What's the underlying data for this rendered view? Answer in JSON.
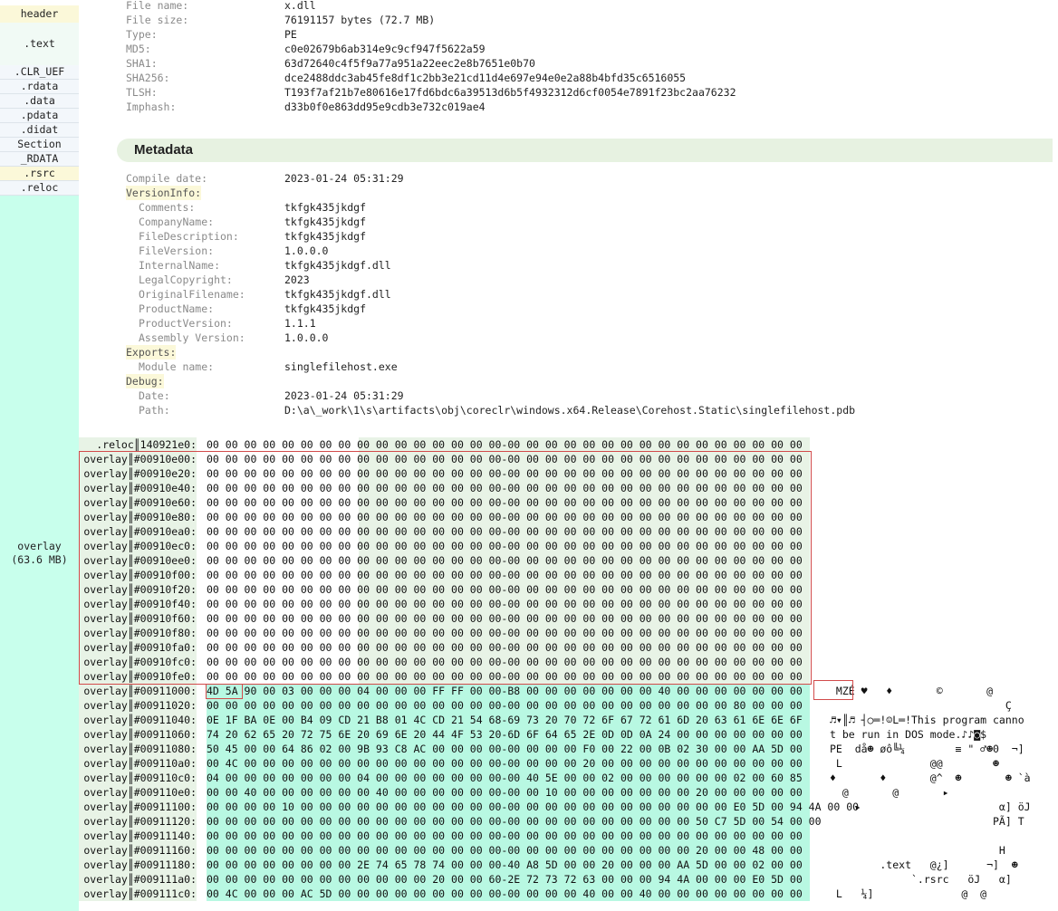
{
  "sidebar": {
    "items": [
      {
        "label": "header"
      },
      {
        "label": ".text"
      },
      {
        "label": ".CLR_UEF"
      },
      {
        "label": ".rdata"
      },
      {
        "label": ".data"
      },
      {
        "label": ".pdata"
      },
      {
        "label": ".didat"
      },
      {
        "label": "Section"
      },
      {
        "label": "_RDATA"
      },
      {
        "label": ".rsrc"
      },
      {
        "label": ".reloc"
      }
    ],
    "overlay": {
      "label": "overlay",
      "size": "(63.6 MB)"
    }
  },
  "file_info": [
    {
      "key": "File name:",
      "value": "x.dll"
    },
    {
      "key": "File size:",
      "value": "76191157 bytes (72.7 MB)"
    },
    {
      "key": "Type:",
      "value": "PE"
    },
    {
      "key": "MD5:",
      "value": "c0e02679b6ab314e9c9cf947f5622a59"
    },
    {
      "key": "SHA1:",
      "value": "63d72640c4f5f9a77a951a22eec2e8b7651e0b70"
    },
    {
      "key": "SHA256:",
      "value": "dce2488ddc3ab45fe8df1c2bb3e21cd11d4e697e94e0e2a88b4bfd35c6516055"
    },
    {
      "key": "TLSH:",
      "value": "T193f7af21b7e80616e17fd6bdc6a39513d6b5f4932312d6cf0054e7891f23bc2aa76232"
    },
    {
      "key": "Imphash:",
      "value": "d33b0f0e863dd95e9cdb3e732c019ae4"
    }
  ],
  "metadata": {
    "title": "Metadata",
    "rows": [
      {
        "key": "Compile date:",
        "value": "2023-01-24 05:31:29",
        "indent": false,
        "section": false
      },
      {
        "key": "VersionInfo:",
        "value": "",
        "indent": false,
        "section": true
      },
      {
        "key": "Comments:",
        "value": "tkfgk435jkdgf",
        "indent": true,
        "section": false
      },
      {
        "key": "CompanyName:",
        "value": "tkfgk435jkdgf",
        "indent": true,
        "section": false
      },
      {
        "key": "FileDescription:",
        "value": "tkfgk435jkdgf",
        "indent": true,
        "section": false
      },
      {
        "key": "FileVersion:",
        "value": "1.0.0.0",
        "indent": true,
        "section": false
      },
      {
        "key": "InternalName:",
        "value": "tkfgk435jkdgf.dll",
        "indent": true,
        "section": false
      },
      {
        "key": "LegalCopyright:",
        "value": "2023",
        "indent": true,
        "section": false
      },
      {
        "key": "OriginalFilename:",
        "value": "tkfgk435jkdgf.dll",
        "indent": true,
        "section": false
      },
      {
        "key": "ProductName:",
        "value": "tkfgk435jkdgf",
        "indent": true,
        "section": false
      },
      {
        "key": "ProductVersion:",
        "value": "1.1.1",
        "indent": true,
        "section": false
      },
      {
        "key": "Assembly Version:",
        "value": "1.0.0.0",
        "indent": true,
        "section": false
      },
      {
        "key": "Exports:",
        "value": "",
        "indent": false,
        "section": true
      },
      {
        "key": "Module name:",
        "value": "singlefilehost.exe",
        "indent": true,
        "section": false
      },
      {
        "key": "Debug:",
        "value": "",
        "indent": false,
        "section": true
      },
      {
        "key": "Date:",
        "value": "2023-01-24 05:31:29",
        "indent": true,
        "section": false
      },
      {
        "key": "Path:",
        "value": "D:\\a\\_work\\1\\s\\artifacts\\obj\\coreclr\\windows.x64.Release\\Corehost.Static\\singlefilehost.pdb",
        "indent": true,
        "section": false
      }
    ]
  },
  "hex": {
    "rows": [
      {
        "label": ".reloc║140921e0:",
        "bytes": "00 00 00 00 00 00 00 00 00 00 00 00 00 00 00 00-00 00 00 00 00 00 00 00 00 00 00 00 00 00 00 00",
        "ascii": "",
        "region": "reloc"
      },
      {
        "label": "overlay║#00910e00:",
        "bytes": "00 00 00 00 00 00 00 00 00 00 00 00 00 00 00 00-00 00 00 00 00 00 00 00 00 00 00 00 00 00 00 00",
        "ascii": "",
        "region": "zero"
      },
      {
        "label": "overlay║#00910e20:",
        "bytes": "00 00 00 00 00 00 00 00 00 00 00 00 00 00 00 00-00 00 00 00 00 00 00 00 00 00 00 00 00 00 00 00",
        "ascii": "",
        "region": "zero"
      },
      {
        "label": "overlay║#00910e40:",
        "bytes": "00 00 00 00 00 00 00 00 00 00 00 00 00 00 00 00-00 00 00 00 00 00 00 00 00 00 00 00 00 00 00 00",
        "ascii": "",
        "region": "zero"
      },
      {
        "label": "overlay║#00910e60:",
        "bytes": "00 00 00 00 00 00 00 00 00 00 00 00 00 00 00 00-00 00 00 00 00 00 00 00 00 00 00 00 00 00 00 00",
        "ascii": "",
        "region": "zero"
      },
      {
        "label": "overlay║#00910e80:",
        "bytes": "00 00 00 00 00 00 00 00 00 00 00 00 00 00 00 00-00 00 00 00 00 00 00 00 00 00 00 00 00 00 00 00",
        "ascii": "",
        "region": "zero"
      },
      {
        "label": "overlay║#00910ea0:",
        "bytes": "00 00 00 00 00 00 00 00 00 00 00 00 00 00 00 00-00 00 00 00 00 00 00 00 00 00 00 00 00 00 00 00",
        "ascii": "",
        "region": "zero"
      },
      {
        "label": "overlay║#00910ec0:",
        "bytes": "00 00 00 00 00 00 00 00 00 00 00 00 00 00 00 00-00 00 00 00 00 00 00 00 00 00 00 00 00 00 00 00",
        "ascii": "",
        "region": "zero"
      },
      {
        "label": "overlay║#00910ee0:",
        "bytes": "00 00 00 00 00 00 00 00 00 00 00 00 00 00 00 00-00 00 00 00 00 00 00 00 00 00 00 00 00 00 00 00",
        "ascii": "",
        "region": "zero"
      },
      {
        "label": "overlay║#00910f00:",
        "bytes": "00 00 00 00 00 00 00 00 00 00 00 00 00 00 00 00-00 00 00 00 00 00 00 00 00 00 00 00 00 00 00 00",
        "ascii": "",
        "region": "zero"
      },
      {
        "label": "overlay║#00910f20:",
        "bytes": "00 00 00 00 00 00 00 00 00 00 00 00 00 00 00 00-00 00 00 00 00 00 00 00 00 00 00 00 00 00 00 00",
        "ascii": "",
        "region": "zero"
      },
      {
        "label": "overlay║#00910f40:",
        "bytes": "00 00 00 00 00 00 00 00 00 00 00 00 00 00 00 00-00 00 00 00 00 00 00 00 00 00 00 00 00 00 00 00",
        "ascii": "",
        "region": "zero"
      },
      {
        "label": "overlay║#00910f60:",
        "bytes": "00 00 00 00 00 00 00 00 00 00 00 00 00 00 00 00-00 00 00 00 00 00 00 00 00 00 00 00 00 00 00 00",
        "ascii": "",
        "region": "zero"
      },
      {
        "label": "overlay║#00910f80:",
        "bytes": "00 00 00 00 00 00 00 00 00 00 00 00 00 00 00 00-00 00 00 00 00 00 00 00 00 00 00 00 00 00 00 00",
        "ascii": "",
        "region": "zero"
      },
      {
        "label": "overlay║#00910fa0:",
        "bytes": "00 00 00 00 00 00 00 00 00 00 00 00 00 00 00 00-00 00 00 00 00 00 00 00 00 00 00 00 00 00 00 00",
        "ascii": "",
        "region": "zero"
      },
      {
        "label": "overlay║#00910fc0:",
        "bytes": "00 00 00 00 00 00 00 00 00 00 00 00 00 00 00 00-00 00 00 00 00 00 00 00 00 00 00 00 00 00 00 00",
        "ascii": "",
        "region": "zero"
      },
      {
        "label": "overlay║#00910fe0:",
        "bytes": "00 00 00 00 00 00 00 00 00 00 00 00 00 00 00 00-00 00 00 00 00 00 00 00 00 00 00 00 00 00 00 00",
        "ascii": "",
        "region": "zero"
      },
      {
        "label": "overlay║#00911000:",
        "bytes": "4D 5A 90 00 03 00 00 00 04 00 00 00 FF FF 00 00-B8 00 00 00 00 00 00 00 40 00 00 00 00 00 00 00",
        "ascii": " MZÉ ♥   ♦       ©       @",
        "region": "data"
      },
      {
        "label": "overlay║#00911020:",
        "bytes": "00 00 00 00 00 00 00 00 00 00 00 00 00 00 00 00-00 00 00 00 00 00 00 00 00 00 00 00 80 00 00 00",
        "ascii": "                            Ç",
        "region": "data"
      },
      {
        "label": "overlay║#00911040:",
        "bytes": "0E 1F BA 0E 00 B4 09 CD 21 B8 01 4C CD 21 54 68-69 73 20 70 72 6F 67 72 61 6D 20 63 61 6E 6E 6F",
        "ascii": "♬▾║♬ ┤○═!☺L═!This program canno",
        "region": "data"
      },
      {
        "label": "overlay║#00911060:",
        "bytes": "74 20 62 65 20 72 75 6E 20 69 6E 20 44 4F 53 20-6D 6F 64 65 2E 0D 0D 0A 24 00 00 00 00 00 00 00",
        "ascii": "t be run in DOS mode.♪♪◙$",
        "region": "data"
      },
      {
        "label": "overlay║#00911080:",
        "bytes": "50 45 00 00 64 86 02 00 9B 93 C8 AC 00 00 00 00-00 00 00 00 F0 00 22 00 0B 02 30 00 00 AA 5D 00",
        "ascii": "PE  då☻ øô╚¼        ≡ \" ♂☻0  ¬]",
        "region": "data"
      },
      {
        "label": "overlay║#009110a0:",
        "bytes": "00 4C 00 00 00 00 00 00 00 00 00 00 00 00 00 00-00 00 00 00 20 00 00 00 00 00 00 00 00 00 00 00",
        "ascii": " L              @@        ☻",
        "region": "data"
      },
      {
        "label": "overlay║#009110c0:",
        "bytes": "04 00 00 00 00 00 00 00 04 00 00 00 00 00 00 00-00 40 5E 00 00 02 00 00 00 00 00 00 02 00 60 85",
        "ascii": "♦       ♦       @^  ☻       ☻ `à",
        "region": "data"
      },
      {
        "label": "overlay║#009110e0:",
        "bytes": "00 00 40 00 00 00 00 00 00 40 00 00 00 00 00 00-00 00 10 00 00 00 00 00 00 00 20 00 00 00 00 00",
        "ascii": "  @       @       ▸",
        "region": "data"
      },
      {
        "label": "overlay║#00911100:",
        "bytes": "00 00 00 00 10 00 00 00 00 00 00 00 00 00 00 00-00 00 00 00 00 00 00 00 00 00 00 00 E0 5D 00 94 4A 00 00",
        "ascii": "    ▸                      α] öJ",
        "region": "data"
      },
      {
        "label": "overlay║#00911120:",
        "bytes": "00 00 00 00 00 00 00 00 00 00 00 00 00 00 00 00-00 00 00 00 00 00 00 00 00 00 50 C7 5D 00 54 00 00",
        "ascii": "                          PÃ] T",
        "region": "data"
      },
      {
        "label": "overlay║#00911140:",
        "bytes": "00 00 00 00 00 00 00 00 00 00 00 00 00 00 00 00-00 00 00 00 00 00 00 00 00 00 00 00 00 00 00 00",
        "ascii": "",
        "region": "data"
      },
      {
        "label": "overlay║#00911160:",
        "bytes": "00 00 00 00 00 00 00 00 00 00 00 00 00 00 00 00-00 00 00 00 00 00 00 00 00 00 20 00 00 48 00 00",
        "ascii": "                           H",
        "region": "data"
      },
      {
        "label": "overlay║#00911180:",
        "bytes": "00 00 00 00 00 00 00 00 2E 74 65 78 74 00 00 00-40 A8 5D 00 00 20 00 00 00 AA 5D 00 00 02 00 00",
        "ascii": "        .text   @¿]      ¬]  ☻",
        "region": "data"
      },
      {
        "label": "overlay║#009111a0:",
        "bytes": "00 00 00 00 00 00 00 00 00 00 00 00 20 00 00 60-2E 72 73 72 63 00 00 00 94 4A 00 00 00 E0 5D 00",
        "ascii": "             `.rsrc   öJ   α]",
        "region": "data"
      },
      {
        "label": "overlay║#009111c0:",
        "bytes": "00 4C 00 00 00 AC 5D 00 00 00 00 00 00 00 00 00-00 00 00 00 40 00 00 40 00 00 00 00 00 00 00 00",
        "ascii": " L   ¼]              @  @",
        "region": "data"
      }
    ]
  },
  "colors": {
    "sidebar_overlay": "#c8ffec",
    "sidebar_header": "#fbf8d9",
    "metadata_header": "#e7f2e1",
    "band_light": "#e8f3e6",
    "band_green": "#d4f7ea",
    "band_teal": "#b8f8e2",
    "selection_box": "#d24b4b"
  }
}
